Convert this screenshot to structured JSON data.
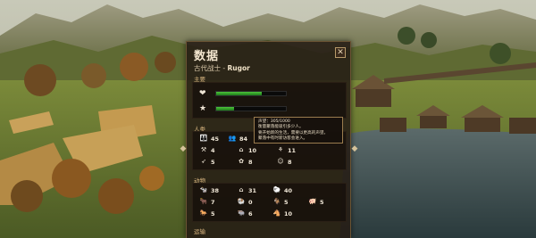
{
  "panel": {
    "title": "数据",
    "close_glyph": "✕",
    "subtitle_prefix": "古代战士 - ",
    "subtitle_name": "Rugor"
  },
  "sections": {
    "main": "主要",
    "people": "人类",
    "animals": "动物",
    "transport": "运输"
  },
  "bars": [
    {
      "icon": "heart-hand-icon",
      "glyph": "❤",
      "fraction": 0.66
    },
    {
      "icon": "star-icon",
      "glyph": "★",
      "fraction": 0.26
    }
  ],
  "tooltip": {
    "header": "声望：305/1000",
    "line1": "衡量聚落能吸引多少人。",
    "line2": "要开始新的生活，需要以更高的声望。",
    "line3": "聚落中有时新访客会进入。"
  },
  "people": [
    {
      "icon": "group-icon",
      "glyph": "👪",
      "value": "45"
    },
    {
      "icon": "adult-icon",
      "glyph": "👥",
      "value": "84"
    },
    {
      "icon": "worker-icon",
      "glyph": "⚒",
      "value": "4"
    },
    {
      "icon": "builder-icon",
      "glyph": "⌂",
      "value": "10"
    },
    {
      "icon": "farmer-icon",
      "glyph": "⚘",
      "value": "11"
    },
    {
      "icon": "hunter-icon",
      "glyph": "➶",
      "value": "5"
    },
    {
      "icon": "gatherer-icon",
      "glyph": "✿",
      "value": "8"
    },
    {
      "icon": "child-icon",
      "glyph": "☺",
      "value": "8"
    }
  ],
  "animals": [
    {
      "icon": "herd-icon",
      "glyph": "🐄",
      "value": "38"
    },
    {
      "icon": "shelter-icon",
      "glyph": "⌂",
      "value": "31"
    },
    {
      "icon": "flock-icon",
      "glyph": "🐑",
      "value": "40"
    },
    {
      "icon": "cow-icon",
      "glyph": "🐂",
      "value": "7"
    },
    {
      "icon": "sheep-icon",
      "glyph": "🐏",
      "value": "0"
    },
    {
      "icon": "goat-icon",
      "glyph": "🐐",
      "value": "5"
    },
    {
      "icon": "pig-icon",
      "glyph": "🐖",
      "value": "5"
    },
    {
      "icon": "horse-icon",
      "glyph": "🐎",
      "value": "5"
    },
    {
      "icon": "ox-icon",
      "glyph": "🐃",
      "value": "6"
    },
    {
      "icon": "donkey-icon",
      "glyph": "🐴",
      "value": "10"
    }
  ],
  "colors": {
    "panel_bg": "#261c14",
    "panel_border": "#6b5434",
    "accent": "#d9b680",
    "bar_green": "#3fb02f"
  }
}
